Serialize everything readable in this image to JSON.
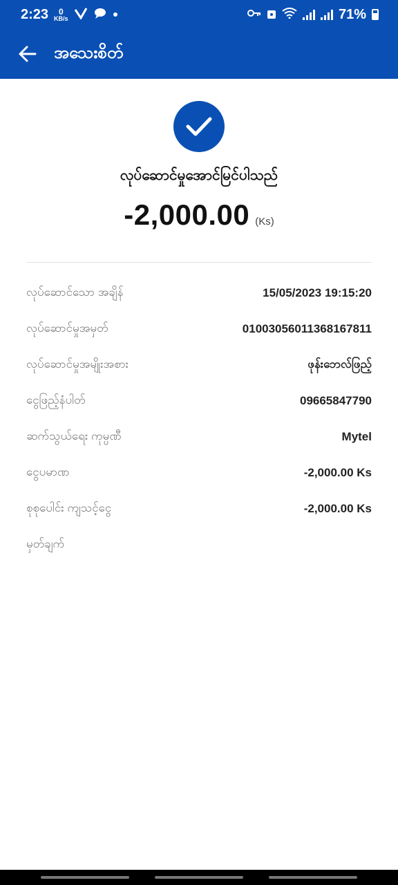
{
  "status_bar": {
    "time": "2:23",
    "net_speed_value": "0",
    "net_speed_unit": "KB/s",
    "battery": "71%"
  },
  "header": {
    "title": "အသေးစိတ်"
  },
  "receipt": {
    "status_text": "လုပ်ဆောင်မှုအောင်မြင်ပါသည်",
    "amount": "-2,000.00",
    "currency": "(Ks)"
  },
  "details": [
    {
      "label": "လုပ်ဆောင်သော အချိန်",
      "value": "15/05/2023 19:15:20"
    },
    {
      "label": "လုပ်ဆောင်မှုအမှတ်",
      "value": "01003056011368167811"
    },
    {
      "label": "လုပ်ဆောင်မှုအမျိုးအစား",
      "value": "ဖုန်းဘေလ်ဖြည့်"
    },
    {
      "label": "ငွေဖြည့်နံပါတ်",
      "value": "09665847790"
    },
    {
      "label": "ဆက်သွယ်ရေး ကုမ္ပဏီ",
      "value": "Mytel"
    },
    {
      "label": "ငွေပမာဏ",
      "value": "-2,000.00 Ks"
    },
    {
      "label": "စုစုပေါင်း ကျသင့်ငွေ",
      "value": "-2,000.00 Ks"
    },
    {
      "label": "မှတ်ချက်",
      "value": ""
    }
  ],
  "colors": {
    "primary": "#0a50b4"
  },
  "icons": {
    "back": "arrow-left-icon",
    "success": "check-icon"
  }
}
